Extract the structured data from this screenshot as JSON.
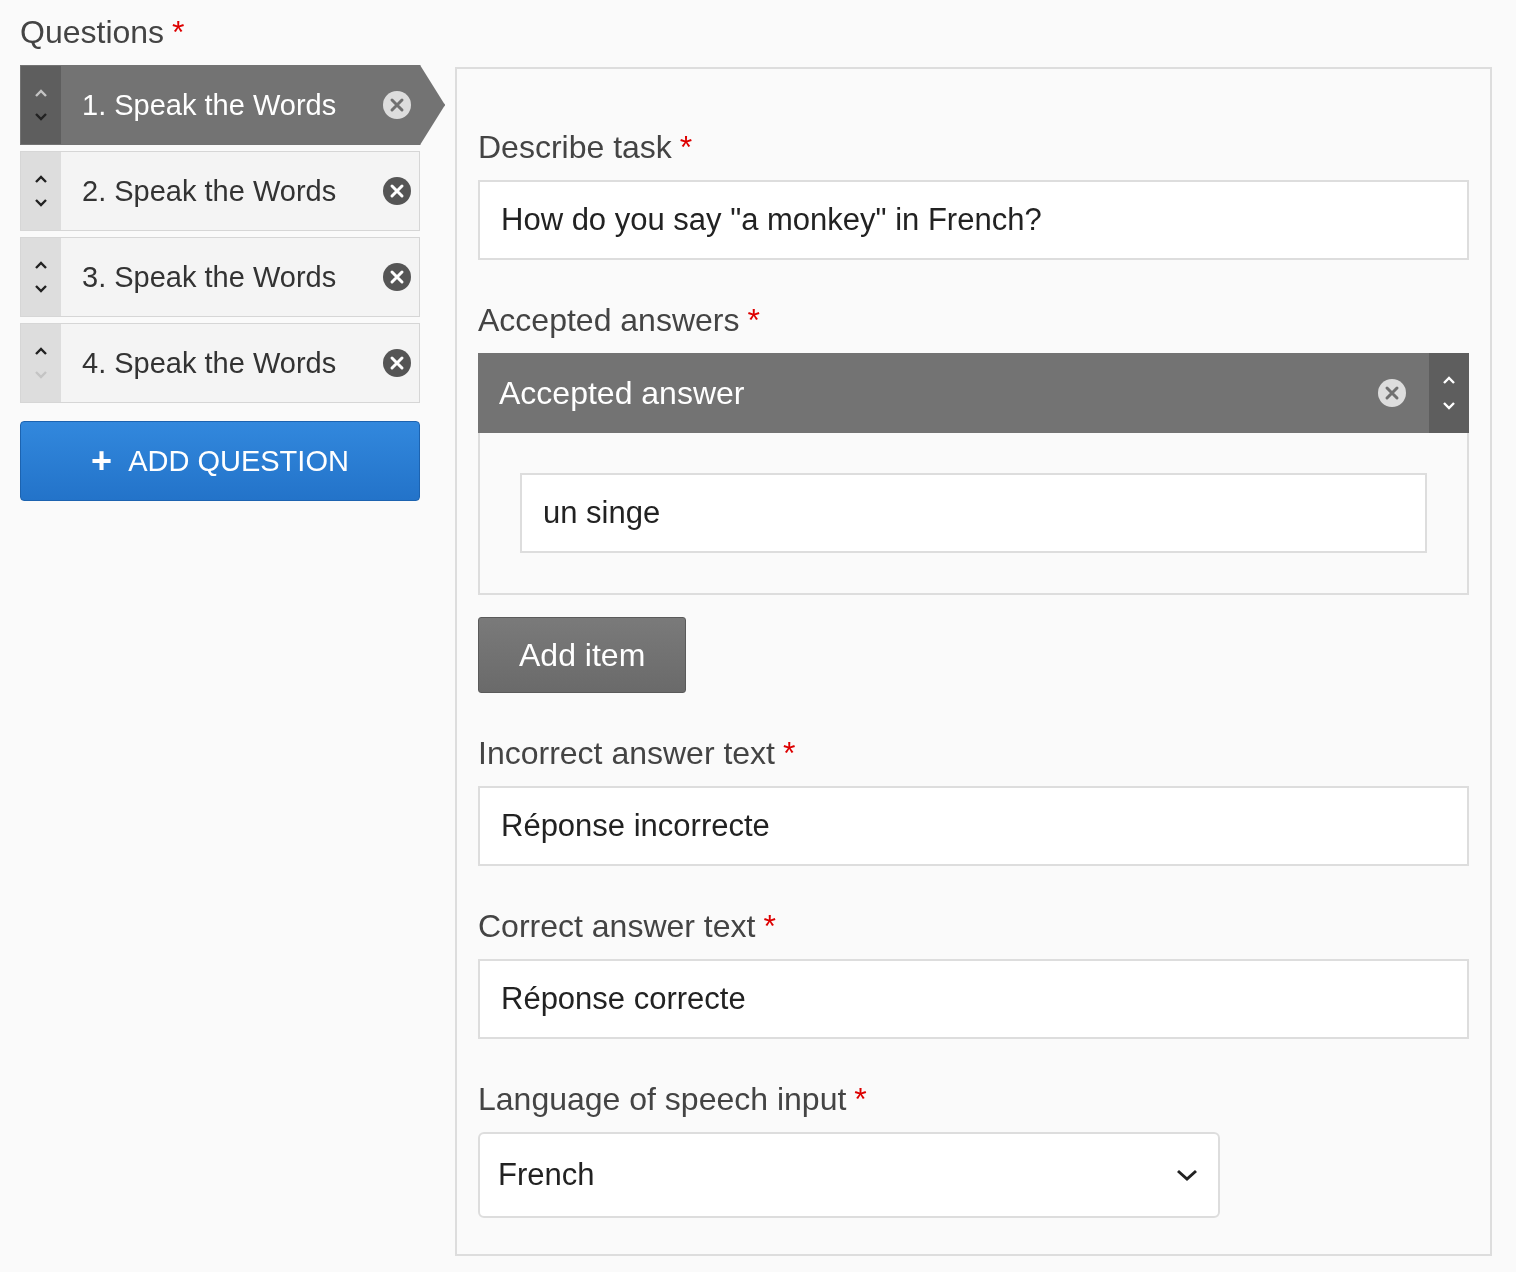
{
  "questions_heading": {
    "text": "Questions",
    "asterisk": "*"
  },
  "questions": [
    {
      "label": "1. Speak the Words",
      "selected": true,
      "can_move_up": false,
      "can_move_down": true
    },
    {
      "label": "2. Speak the Words",
      "selected": false,
      "can_move_up": true,
      "can_move_down": true
    },
    {
      "label": "3. Speak the Words",
      "selected": false,
      "can_move_up": true,
      "can_move_down": true
    },
    {
      "label": "4. Speak the Words",
      "selected": false,
      "can_move_up": true,
      "can_move_down": false
    }
  ],
  "add_question": {
    "icon": "+",
    "label": "ADD QUESTION"
  },
  "editor": {
    "describe_task": {
      "label": "Describe task",
      "asterisk": "*",
      "value": "How do you say \"a monkey\" in French?"
    },
    "accepted_answers": {
      "label": "Accepted answers",
      "asterisk": "*",
      "items": [
        {
          "title": "Accepted answer",
          "value": "un singe"
        }
      ],
      "add_item": "Add item"
    },
    "incorrect_answer_text": {
      "label": "Incorrect answer text",
      "asterisk": "*",
      "value": "Réponse incorrecte"
    },
    "correct_answer_text": {
      "label": "Correct answer text",
      "asterisk": "*",
      "value": "Réponse correcte"
    },
    "language": {
      "label": "Language of speech input",
      "asterisk": "*",
      "value": "French"
    }
  }
}
